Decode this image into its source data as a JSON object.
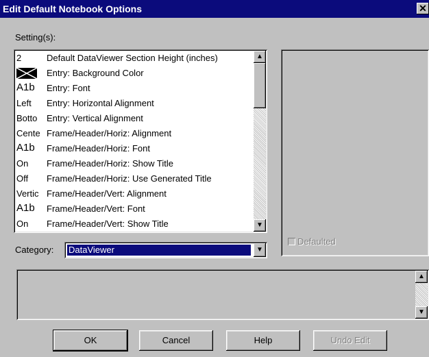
{
  "window": {
    "title": "Edit Default Notebook Options",
    "close_glyph": "✕"
  },
  "settings": {
    "label": "Setting(s):",
    "rows": [
      {
        "value": "2",
        "name": "Default DataViewer Section Height (inches)"
      },
      {
        "value": "",
        "icon": "color-swatch-icon",
        "name": "Entry: Background Color"
      },
      {
        "value": "A1b",
        "name": "Entry: Font"
      },
      {
        "value": "Left",
        "name": "Entry: Horizontal Alignment"
      },
      {
        "value": "Botto",
        "name": "Entry: Vertical Alignment"
      },
      {
        "value": "Cente",
        "name": "Frame/Header/Horiz: Alignment"
      },
      {
        "value": "A1b",
        "name": "Frame/Header/Horiz: Font"
      },
      {
        "value": "On",
        "name": "Frame/Header/Horiz: Show Title"
      },
      {
        "value": "Off",
        "name": "Frame/Header/Horiz: Use Generated Title"
      },
      {
        "value": "Vertic",
        "name": "Frame/Header/Vert: Alignment"
      },
      {
        "value": "A1b",
        "name": "Frame/Header/Vert: Font"
      },
      {
        "value": "On",
        "name": "Frame/Header/Vert: Show Title"
      }
    ],
    "scroll_up_glyph": "▲",
    "scroll_down_glyph": "▼"
  },
  "defaulted": {
    "label": "Defaulted",
    "checked": false
  },
  "category": {
    "label": "Category:",
    "value": "DataViewer",
    "arrow_glyph": "▼"
  },
  "description": {
    "scroll_up_glyph": "▲",
    "scroll_down_glyph": "▼"
  },
  "buttons": {
    "ok": "OK",
    "cancel": "Cancel",
    "help": "Help",
    "undo": "Undo Edit"
  }
}
